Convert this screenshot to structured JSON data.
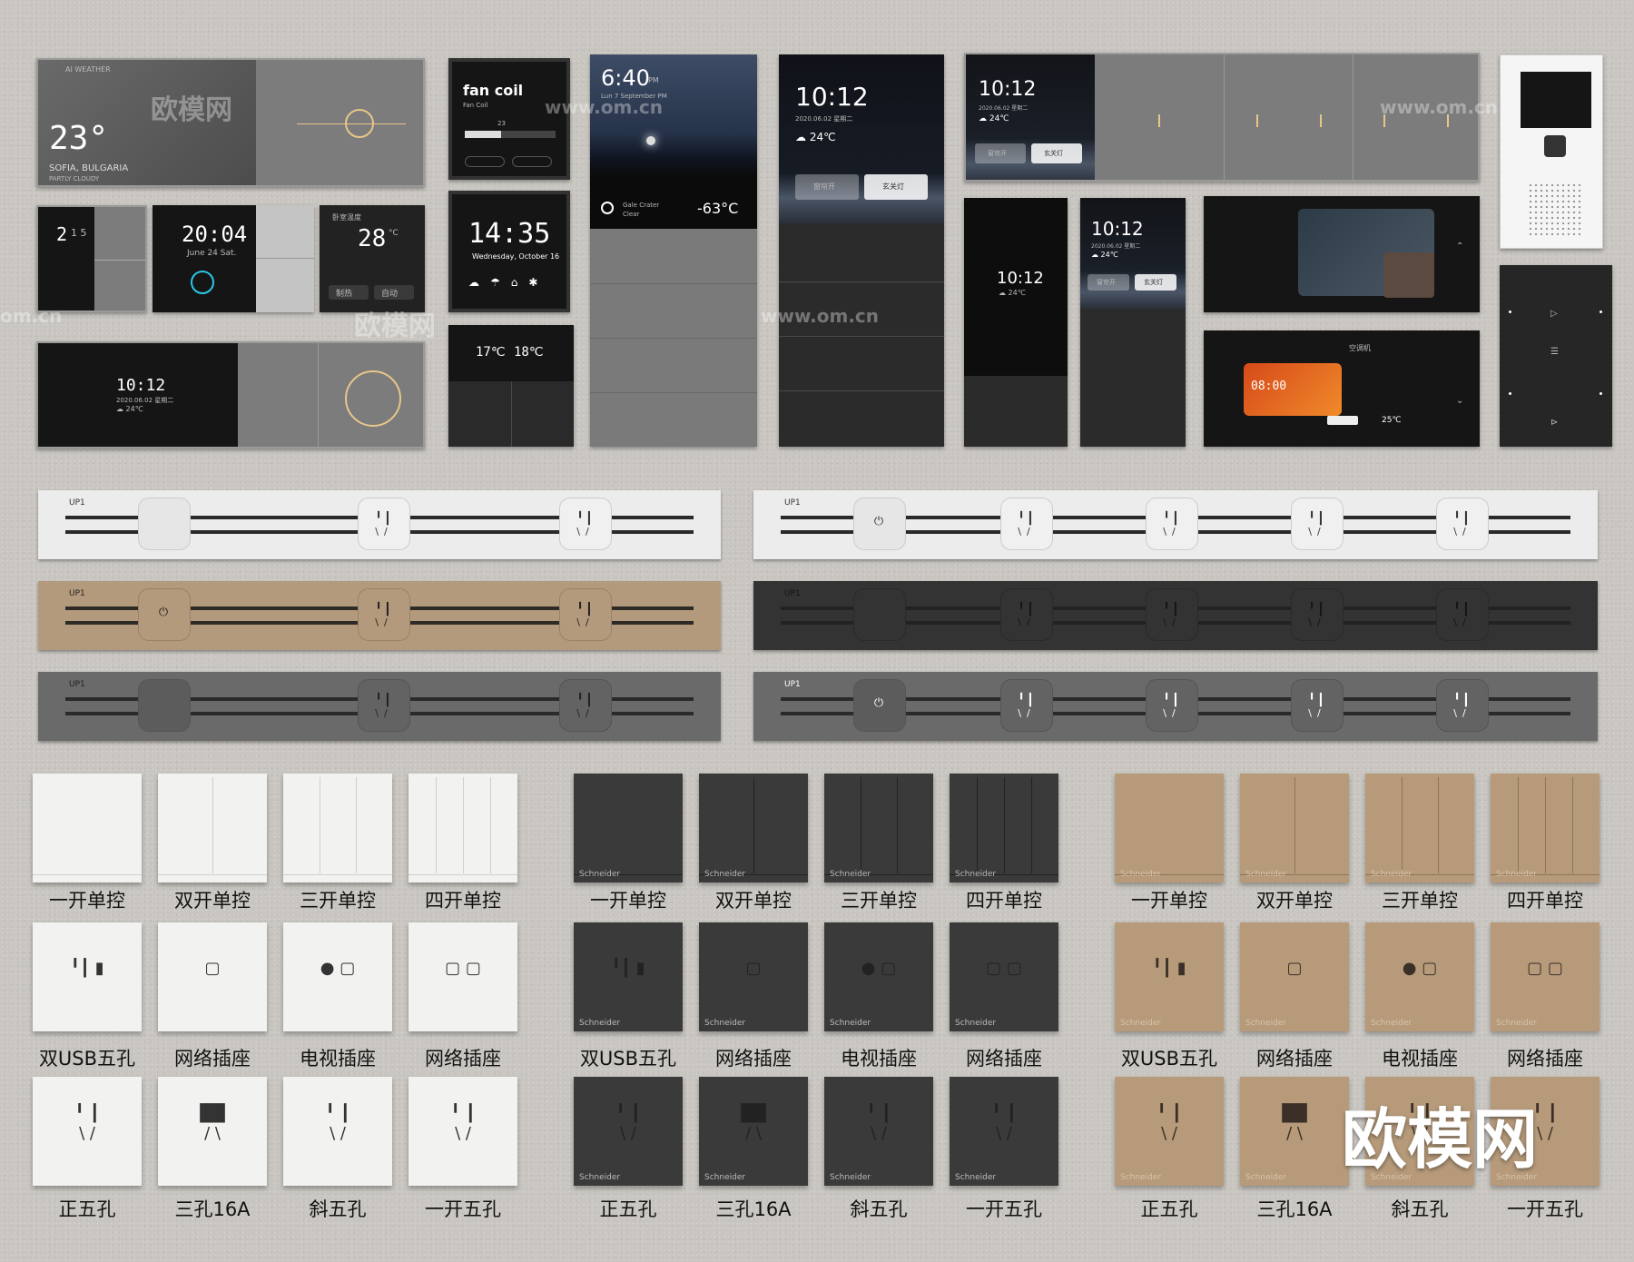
{
  "screens": {
    "weather": {
      "brand": "AI WEATHER",
      "temp": "23°",
      "city": "SOFIA, BULGARIA",
      "cond": "PARTLY CLOUDY"
    },
    "fancoil": {
      "title": "fan coil",
      "sub": "Fan Coil",
      "level": "23"
    },
    "night": {
      "time": "6:40",
      "ampm": "PM",
      "date": "Lun 7 September PM",
      "place": "Gale Crater",
      "cond": "Clear",
      "temp": "-63°C"
    },
    "tall_clock": {
      "time": "10:12",
      "date": "2020.06.02 星期二",
      "weather": "☁ 24℃",
      "btn1": "窗帘开",
      "btn2": "玄关灯"
    },
    "wide_clock": {
      "time": "10:12",
      "date": "2020.06.02 星期二",
      "weather": "☁ 24℃",
      "btn1": "窗帘开",
      "btn2": "玄关灯"
    },
    "small_a": {
      "time": "2",
      "sub": "1 5"
    },
    "small_b": {
      "time": "20:04",
      "date": "June 24 Sat."
    },
    "small_c": {
      "title": "卧室温度",
      "temp": "28",
      "unit": "°C",
      "btn1": "制热",
      "btn2": "自动"
    },
    "clock1435": {
      "time": "14:35",
      "date": "Wednesday, October 16"
    },
    "black_clock": {
      "time": "10:12",
      "date": "2020.06.02 星期二",
      "weather": "☁ 24℃"
    },
    "tile1012": {
      "time": "10:12",
      "weather": "☁ 24℃"
    },
    "mid1012": {
      "time": "10:12",
      "date": "2020.06.02 星期二",
      "weather": "☁ 24℃",
      "btn1": "窗帘开",
      "btn2": "玄关灯"
    },
    "temp_dual": {
      "t1": "17℃",
      "t2": "18℃"
    },
    "smart": {
      "ac": "空调机",
      "time": "08:00",
      "temp": "25℃"
    }
  },
  "strips": {
    "label": "UP1"
  },
  "labels": {
    "row1": [
      "一开单控",
      "双开单控",
      "三开单控",
      "四开单控"
    ],
    "row2": [
      "双USB五孔",
      "网络插座",
      "电视插座",
      "网络插座"
    ],
    "row3": [
      "正五孔",
      "三孔16A",
      "斜五孔",
      "一开五孔"
    ]
  },
  "brand": "Schneider",
  "watermark": {
    "logo": "欧模网",
    "url": "www.om.cn",
    "short": "om.cn"
  },
  "colors": {
    "white": "#f2f2f0",
    "black": "#3a3a3a",
    "tan": "#b69a7a",
    "gold": "#e8c68a"
  }
}
